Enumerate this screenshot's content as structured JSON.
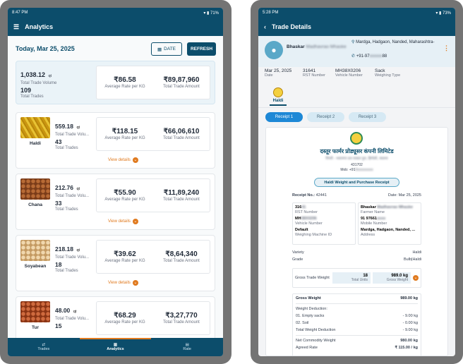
{
  "left": {
    "status": {
      "time": "8:47 PM",
      "battery": "71%"
    },
    "appbar": {
      "title": "Analytics"
    },
    "date_heading": "Today, Mar 25, 2025",
    "date_button": "DATE",
    "refresh_button": "REFRESH",
    "summary": {
      "volume_value": "1,038.12",
      "volume_unit": "qt",
      "volume_label": "Total Trade Volume",
      "trades_value": "109",
      "trades_label": "Total Trades",
      "avg_rate": "₹86.58",
      "avg_rate_label": "Average Rate per KG",
      "total_amount": "₹89,87,960",
      "total_amount_label": "Total Trade Amount"
    },
    "commodities": [
      {
        "name": "Haldi",
        "volume": "559.18",
        "unit": "qt",
        "volume_label": "Total Trade Volu...",
        "trades": "43",
        "trades_label": "Total Trades",
        "avg_rate": "₹118.15",
        "avg_rate_label": "Average Rate per KG",
        "amount": "₹66,06,610",
        "amount_label": "Total Trade Amount",
        "view": "View details",
        "color": "#d4a516"
      },
      {
        "name": "Chana",
        "volume": "212.76",
        "unit": "qt",
        "volume_label": "Total Trade Volu...",
        "trades": "33",
        "trades_label": "Total Trades",
        "avg_rate": "₹55.90",
        "avg_rate_label": "Average Rate per KG",
        "amount": "₹11,89,240",
        "amount_label": "Total Trade Amount",
        "view": "View details",
        "color": "#8b4a22"
      },
      {
        "name": "Soyabean",
        "volume": "218.18",
        "unit": "qt",
        "volume_label": "Total Trade Volu...",
        "trades": "18",
        "trades_label": "Total Trades",
        "avg_rate": "₹39.62",
        "avg_rate_label": "Average Rate per KG",
        "amount": "₹8,64,340",
        "amount_label": "Total Trade Amount",
        "view": "View details",
        "color": "#d9b888"
      },
      {
        "name": "Tur",
        "volume": "48.00",
        "unit": "qt",
        "volume_label": "Total Trade Volu...",
        "trades": "15",
        "trades_label": "",
        "avg_rate": "₹68.29",
        "avg_rate_label": "Average Rate per KG",
        "amount": "₹3,27,770",
        "amount_label": "Total Trade Amount",
        "view": "",
        "color": "#a0441f"
      }
    ],
    "nav": [
      "Trades",
      "Analytics",
      "Rate"
    ]
  },
  "right": {
    "status": {
      "time": "5:28 PM",
      "battery": "73%"
    },
    "appbar": {
      "title": "Trade Details"
    },
    "farmer": {
      "name": "Bhaskar",
      "name_blur": "Madhavrao Mhaske",
      "address": "Mardga, Hadgaon, Nanded, Maharashtra-",
      "phone": "+91-97",
      "phone_blur": "xxxxxx",
      "phone_end": "88"
    },
    "info": [
      {
        "value": "Mar 25, 2025",
        "label": "Date"
      },
      {
        "value": "31641",
        "label": "RST Number"
      },
      {
        "value": "MH38X0206",
        "label": "Vehicle Number"
      },
      {
        "value": "Sack",
        "label": "Weighing Type"
      }
    ],
    "commodity_tab": "Haldi",
    "receipts": [
      "Receipt 1",
      "Receipt 2",
      "Receipt 3"
    ],
    "receipt": {
      "company": "दस्तूर फार्मर प्रोड्यूसर कंपनी लिमिटेड",
      "company_sub_blur": "पिंपरी - भवानगर दत्त वत्सल पुरा, हिंगोली, जालना",
      "pincode": "431702",
      "mob": "Mob: +91",
      "mob_blur": "9xxxxxxxxx",
      "title": "Haldi Weight and Purchase Receipt",
      "receipt_no_label": "Receipt No.:",
      "receipt_no": "42441",
      "date": "Date: Mar 25, 2025",
      "rst": "316",
      "rst_blur": "41",
      "rst_label": "RST Number",
      "farmer_name": "Bhaskar",
      "farmer_name_blur": "Madhavrao Mhaske",
      "farmer_label": "Farmer Name",
      "vehicle": "MH",
      "vehicle_blur": "38X0206",
      "vehicle_label": "Vehicle Number",
      "mobile": "91 97661",
      "mobile_blur": "xxxx",
      "mobile_label": "Mobile Number",
      "machine": "Default",
      "machine_label": "Weighing Machine ID",
      "address": "Mardga, Hadgaon, Nanded, ...",
      "address_label": "Address",
      "variety_label": "Variety",
      "variety": "Haldi",
      "grade_label": "Grade",
      "grade": "Bulb|Haldi",
      "gross_trade_label": "Gross Trade Weight",
      "units": "18",
      "units_label": "Total Units",
      "gross_kg": "989.0 kg",
      "gross_kg_label": "Gross Weight",
      "gross_weight_label": "Gross Weight",
      "gross_weight": "989.00",
      "gross_weight_unit": "kg",
      "deduction_label": "Weight Deduction:",
      "ded1_label": "01. Empty sacks",
      "ded1": "- 9.00",
      "ded2_label": "02. Soil",
      "ded2": "- 0.00",
      "ded_total_label": "Total Weight Deduction",
      "ded_total": "- 9.00",
      "unit": "kg",
      "net_label": "Net Commodity Weight",
      "net": "980.00",
      "rate_label": "Agreed Rate",
      "rate": "₹ 115.00 / kg"
    }
  }
}
